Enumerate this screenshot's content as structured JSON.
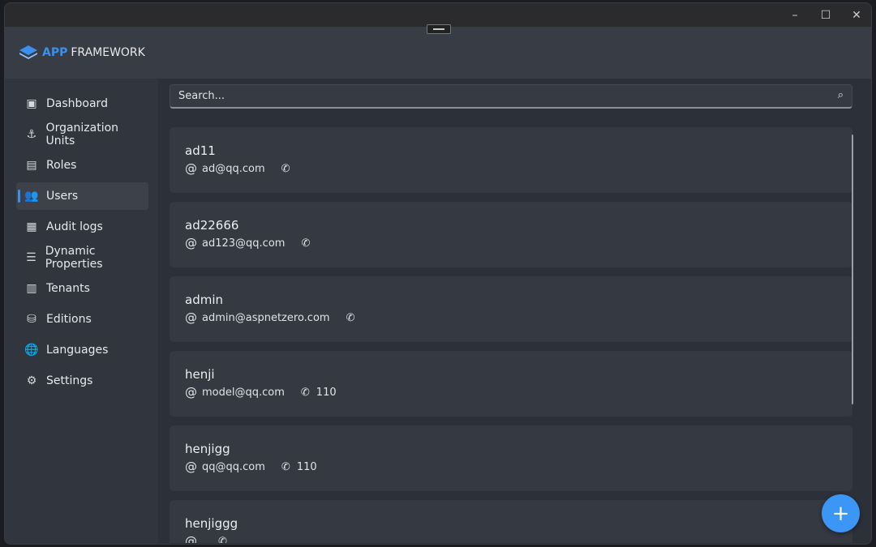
{
  "app": {
    "logo_app": "APP",
    "logo_framework": "FRAMEWORK",
    "accent": "#3b8ff0"
  },
  "window_controls": {
    "minimize": "–",
    "maximize": "☐",
    "close": "✕"
  },
  "sidebar": {
    "items": [
      {
        "label": "Dashboard",
        "icon": "▣",
        "icon_name": "dashboard-icon"
      },
      {
        "label": "Organization Units",
        "icon": "⚓",
        "icon_name": "anchor-icon"
      },
      {
        "label": "Roles",
        "icon": "▤",
        "icon_name": "id-card-icon"
      },
      {
        "label": "Users",
        "icon": "👥",
        "icon_name": "users-icon",
        "active": true
      },
      {
        "label": "Audit logs",
        "icon": "▦",
        "icon_name": "clipboard-icon"
      },
      {
        "label": "Dynamic Properties",
        "icon": "☰",
        "icon_name": "properties-icon"
      },
      {
        "label": "Tenants",
        "icon": "▥",
        "icon_name": "building-icon"
      },
      {
        "label": "Editions",
        "icon": "⛁",
        "icon_name": "database-icon"
      },
      {
        "label": "Languages",
        "icon": "🌐",
        "icon_name": "globe-icon"
      },
      {
        "label": "Settings",
        "icon": "⚙",
        "icon_name": "gear-icon"
      }
    ]
  },
  "search": {
    "placeholder": "Search..."
  },
  "users": [
    {
      "name": "ad11",
      "email": "ad@qq.com",
      "phone": ""
    },
    {
      "name": "ad22666",
      "email": "ad123@qq.com",
      "phone": ""
    },
    {
      "name": "admin",
      "email": "admin@aspnetzero.com",
      "phone": ""
    },
    {
      "name": "henji",
      "email": "model@qq.com",
      "phone": "110"
    },
    {
      "name": "henjigg",
      "email": "qq@qq.com",
      "phone": "110"
    },
    {
      "name": "henjiggg",
      "email": "",
      "phone": ""
    }
  ],
  "fab": {
    "label": "+"
  }
}
